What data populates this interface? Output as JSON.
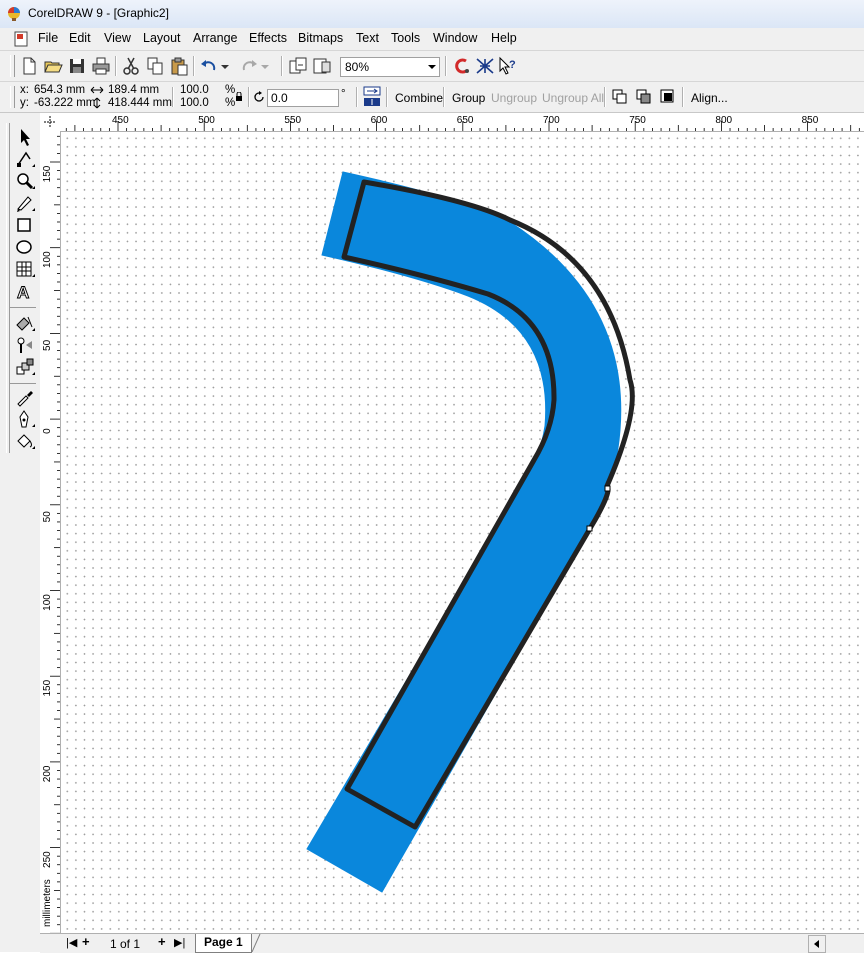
{
  "window": {
    "title": "CorelDRAW 9 - [Graphic2]"
  },
  "menu": [
    "File",
    "Edit",
    "View",
    "Layout",
    "Arrange",
    "Effects",
    "Bitmaps",
    "Text",
    "Tools",
    "Window",
    "Help"
  ],
  "toolbar": {
    "zoom_value": "80%",
    "icons": [
      "new-icon",
      "open-icon",
      "save-icon",
      "print-icon",
      "cut-icon",
      "copy-icon",
      "paste-icon",
      "undo-icon",
      "redo-icon",
      "import-icon",
      "export-icon",
      "application-launcher-icon",
      "corel-online-icon",
      "whats-this-icon"
    ]
  },
  "property_bar": {
    "x_label": "x:",
    "x_value": "654.3 mm",
    "y_label": "y:",
    "y_value": "-63.222 mm",
    "width_value": "189.4 mm",
    "height_value": "418.444 mm",
    "scale_x": "100.0",
    "scale_y": "100.0",
    "percent_sign": "%",
    "rotation_value": "0.0",
    "degree_sign": "°",
    "combine_label": "Combine",
    "group_label": "Group",
    "ungroup_label": "Ungroup",
    "ungroup_all_label": "Ungroup All",
    "align_label": "Align..."
  },
  "ruler": {
    "top_labels": [
      "450",
      "500",
      "550",
      "600",
      "650",
      "700",
      "750",
      "800",
      "850"
    ],
    "left_labels": [
      "150",
      "100",
      "50",
      "0",
      "50",
      "100",
      "150",
      "200",
      "250"
    ],
    "units_label": "millimeters"
  },
  "status": {
    "page_count": "1 of 1",
    "page_tab_label": "Page 1"
  },
  "colors": {
    "shape_fill": "#0a87dc",
    "outline": "#222222",
    "title_bar": "#dbe6f6"
  },
  "tools": [
    "pick-tool-icon",
    "shape-tool-icon",
    "zoom-tool-icon",
    "freehand-tool-icon",
    "rectangle-tool-icon",
    "ellipse-tool-icon",
    "graph-paper-tool-icon",
    "text-tool-icon",
    "interactive-fill-tool-icon",
    "interactive-blend-tool-icon",
    "interactive-transparency-tool-icon",
    "eyedropper-tool-icon",
    "outline-tool-icon",
    "fill-tool-icon"
  ]
}
